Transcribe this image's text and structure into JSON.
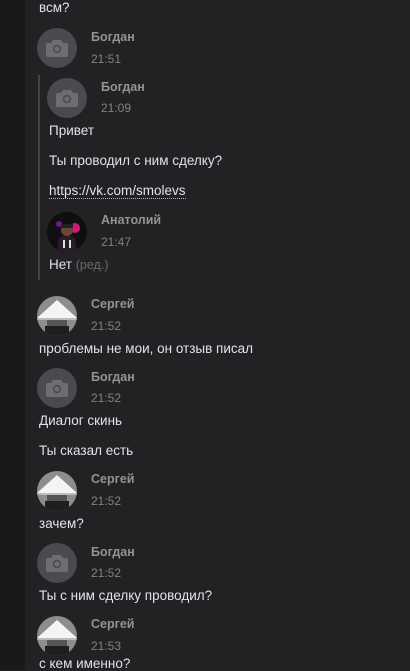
{
  "top_message": "всм?",
  "messages": [
    {
      "sender": "Богдан",
      "time": "21:51"
    },
    {
      "sender": "Сергей",
      "time": "21:52",
      "lines": [
        "проблемы не мои, он отзыв писал"
      ]
    },
    {
      "sender": "Богдан",
      "time": "21:52",
      "lines": [
        "Диалог скинь",
        "Ты сказал есть"
      ]
    },
    {
      "sender": "Сергей",
      "time": "21:52",
      "lines": [
        "зачем?"
      ]
    },
    {
      "sender": "Богдан",
      "time": "21:52",
      "lines": [
        "Ты с ним сделку проводил?"
      ]
    },
    {
      "sender": "Сергей",
      "time": "21:53",
      "lines": [
        "с кем именно?"
      ]
    }
  ],
  "forwarded": {
    "sender": "Богдан",
    "time": "21:09",
    "lines": [
      "Привет",
      "Ты проводил с ним сделку?"
    ],
    "link": "https://vk.com/smolevs",
    "nested": {
      "sender": "Анатолий",
      "time": "21:47",
      "text": "Нет",
      "edited_label": "(ред.)"
    }
  },
  "icons": {
    "camera": "camera-icon"
  },
  "colors": {
    "background": "#222225",
    "text": "#e1e3e6",
    "name": "#939393",
    "time": "#828282"
  }
}
